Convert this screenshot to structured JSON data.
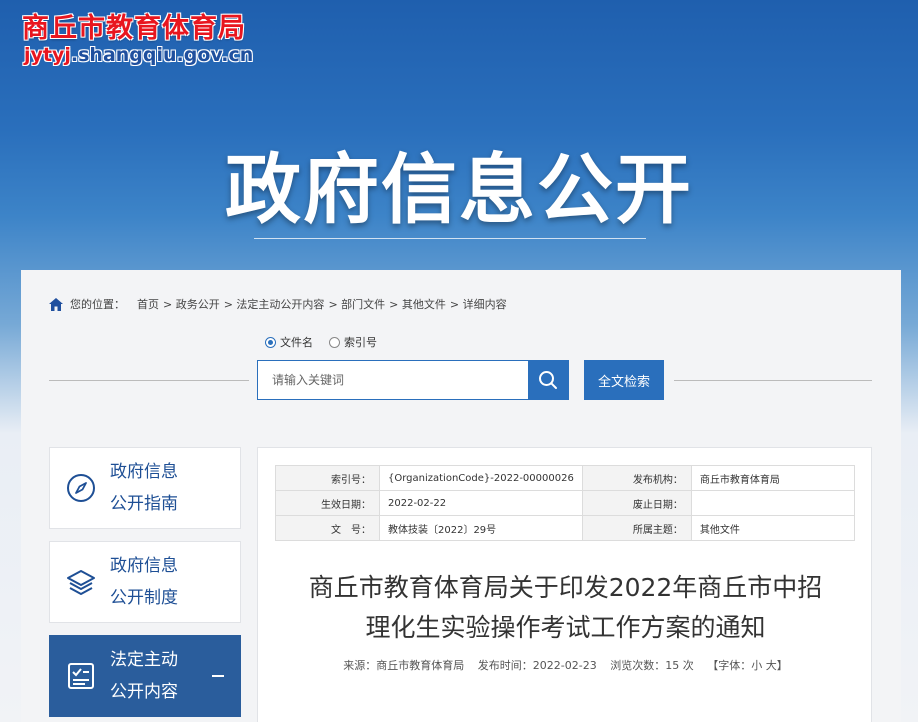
{
  "header": {
    "logo_title": "商丘市教育体育局",
    "logo_url_prefix": "jytyj",
    "logo_url_rest": ".shangqiu.gov.cn",
    "banner_title": "政府信息公开"
  },
  "breadcrumb": {
    "label": "您的位置：",
    "items": [
      "首页",
      "> 政务公开",
      "> 法定主动公开内容",
      "> 部门文件",
      "> 其他文件",
      "> 详细内容"
    ]
  },
  "search": {
    "radio_filename": "文件名",
    "radio_index": "索引号",
    "selected": "文件名",
    "placeholder": "请输入关键词",
    "fulltext_button": "全文检索"
  },
  "sidebar": {
    "items": [
      {
        "line1": "政府信息",
        "line2": "公开指南",
        "icon": "compass-icon"
      },
      {
        "line1": "政府信息",
        "line2": "公开制度",
        "icon": "layers-icon"
      },
      {
        "line1": "法定主动",
        "line2": "公开内容",
        "icon": "checklist-icon",
        "active": true
      }
    ]
  },
  "meta": {
    "index_label": "索引号：",
    "index_value": "{OrganizationCode}-2022-00000026",
    "org_label": "发布机构：",
    "org_value": "商丘市教育体育局",
    "effective_label": "生效日期：",
    "effective_value": "2022-02-22",
    "abolish_label": "废止日期：",
    "abolish_value": "",
    "docno_label": "文　号：",
    "docno_value": "教体技装〔2022〕29号",
    "topic_label": "所属主题：",
    "topic_value": "其他文件"
  },
  "document": {
    "title_line1": "商丘市教育体育局关于印发2022年商丘市中招",
    "title_line2": "理化生实验操作考试工作方案的通知",
    "source": "来源：商丘市教育体育局",
    "publish_time": "发布时间：2022-02-23",
    "views": "浏览次数：15 次",
    "font_size": "【字体：小 大】"
  },
  "colors": {
    "primary": "#2a6fbc",
    "logo_red": "#e8161f",
    "sidebar_active": "#2a5d9c"
  }
}
